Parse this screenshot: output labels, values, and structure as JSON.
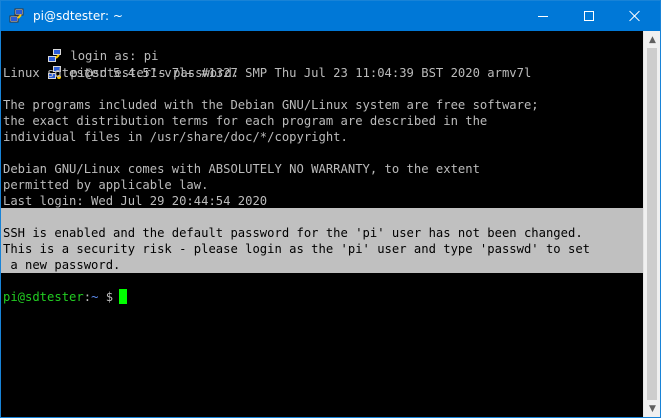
{
  "window": {
    "title": "pi@sdtester: ~",
    "title_bar_color": "#0078d7"
  },
  "controls": {
    "minimize_icon": "minimize-icon",
    "maximize_icon": "maximize-icon",
    "close_icon": "close-icon"
  },
  "terminal": {
    "login_line": "login as: pi",
    "password_line": "pi@sdtester's password:",
    "lines": [
      "Linux sdtester 5.4.51-v7l+ #1327 SMP Thu Jul 23 11:04:39 BST 2020 armv7l",
      "",
      "The programs included with the Debian GNU/Linux system are free software;",
      "the exact distribution terms for each program are described in the",
      "individual files in /usr/share/doc/*/copyright.",
      "",
      "Debian GNU/Linux comes with ABSOLUTELY NO WARRANTY, to the extent",
      "permitted by applicable law.",
      "Last login: Wed Jul 29 20:44:54 2020"
    ],
    "warning_lines": [
      "SSH is enabled and the default password for the 'pi' user has not been changed.",
      "This is a security risk - please login as the 'pi' user and type 'passwd' to set",
      " a new password."
    ],
    "prompt_user": "pi@sdtester",
    "prompt_sep": ":",
    "prompt_path": "~",
    "prompt_symbol": " $",
    "colors": {
      "text": "#bbbbbb",
      "prompt_user": "#22cc22",
      "prompt_path": "#5b8bf0",
      "cursor": "#00ff00",
      "highlight": "#c0c0c0"
    }
  }
}
